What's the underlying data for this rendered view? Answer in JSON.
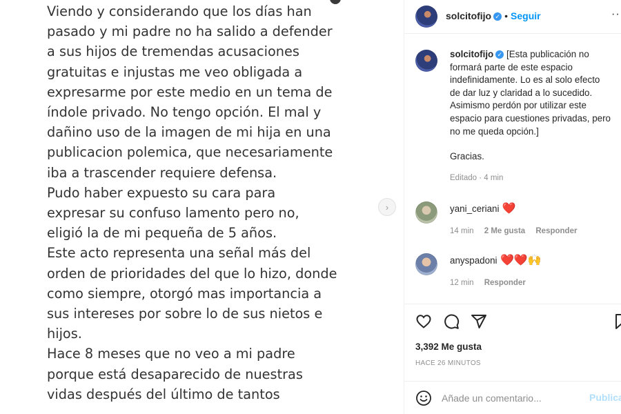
{
  "post_image": {
    "text_lines": [
      "Viendo y considerando que los días han",
      "pasado y mi padre no ha salido a defender",
      "a sus hijos de tremendas acusaciones",
      "gratuitas e injustas me veo obligada a",
      "expresarme por este medio en un tema de",
      "índole privado. No tengo opción. El mal y",
      "dañino uso de la imagen de mi hija en una",
      "publicacion polemica, que necesariamente",
      "iba a trascender requiere defensa.",
      "Pudo haber expuesto su cara para",
      "expresar su confuso lamento pero no,",
      "eligió la de mi pequeña de 5 años.",
      "Este acto representa una señal más del",
      "orden de prioridades del que lo hizo, donde",
      "como siempre, otorgó mas importancia a",
      "sus intereses por sobre lo de sus nietos e",
      "hijos.",
      "Hace 8 meses que no veo a mi padre",
      "porque está desaparecido de nuestras",
      "vidas después del último de tantos"
    ]
  },
  "header": {
    "username": "solcitofijo",
    "separator": "•",
    "follow_label": "Seguir",
    "more_label": "···"
  },
  "caption": {
    "username": "solcitofijo",
    "text": "[Esta publicación no formará parte de este espacio indefinidamente. Lo es al solo efecto de dar luz y claridad a lo sucedido. Asimismo perdón por utilizar este espacio para cuestiones privadas, pero no me queda opción.]",
    "text_lines": [
      "[Esta publicación no",
      "formará parte de este espacio",
      "indefinidamente. Lo es al solo efecto",
      "de dar luz y claridad a lo sucedido.",
      "Asimismo perdón por utilizar este",
      "espacio para cuestiones privadas, pero",
      "no me queda opción.]"
    ],
    "thanks": "Gracias.",
    "meta": "Editado · 4 min"
  },
  "comments": [
    {
      "username": "yani_ceriani",
      "text": "❤️",
      "time": "14 min",
      "likes": "2 Me gusta",
      "reply": "Responder"
    },
    {
      "username": "anyspadoni",
      "text": "❤️❤️🙌",
      "time": "12 min",
      "reply": "Responder"
    }
  ],
  "likes": "3,392 Me gusta",
  "posted": "HACE 26 MINUTOS",
  "comment_bar": {
    "placeholder": "Añade un comentario...",
    "publish_label": "Publicar"
  },
  "nav_arrow": "›",
  "colors": {
    "accent": "#0095f6",
    "verified": "#3897f0",
    "heart": "#ed1c24",
    "muted": "#8e8e8e",
    "publish_disabled": "#b2dffc"
  }
}
